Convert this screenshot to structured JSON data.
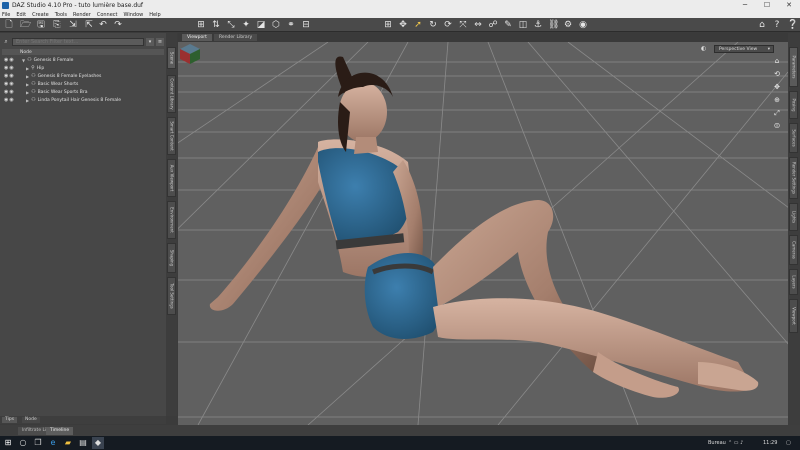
{
  "window": {
    "title": "DAZ Studio 4.10 Pro - tuto lumière base.duf",
    "controls": [
      "─",
      "☐",
      "✕"
    ]
  },
  "menu": [
    "File",
    "Edit",
    "Create",
    "Tools",
    "Render",
    "Connect",
    "Window",
    "Help"
  ],
  "toolbar": {
    "left_icons": [
      "new-icon",
      "open-icon",
      "save-icon",
      "save-as-icon",
      "import-icon",
      "export-icon",
      "undo-icon",
      "redo-icon"
    ],
    "center_left_icons": [
      "scene-icon",
      "align-icon",
      "transform-icon",
      "node-icon",
      "surface-icon",
      "geometry-icon",
      "joint-icon",
      "ruler-icon"
    ],
    "center_icons": [
      "camera-icon",
      "move-icon",
      "select-icon",
      "rotate-icon",
      "spin-icon",
      "translate-icon",
      "scale-icon",
      "pose-icon",
      "surface-selection-icon",
      "region-icon",
      "bone-icon",
      "link-icon",
      "render-settings-icon",
      "render-icon"
    ],
    "right_icons": [
      "home-icon",
      "help-icon",
      "question-icon"
    ]
  },
  "scene": {
    "search_placeholder": "Enter Search Filter text...",
    "header_label": "Node",
    "nodes": [
      {
        "label": "Genesis 8 Female",
        "depth": 0
      },
      {
        "label": "Hip",
        "depth": 1
      },
      {
        "label": "Genesis 8 Female Eyelashes",
        "depth": 1
      },
      {
        "label": "Basic Wear Shorts",
        "depth": 1
      },
      {
        "label": "Basic Wear Sports Bra",
        "depth": 1
      },
      {
        "label": "Linda Ponytail Hair Genesis 8 Female",
        "depth": 1
      }
    ],
    "bottom_tabs": [
      "Tips",
      "Node"
    ]
  },
  "left_side_tabs": [
    "Scene",
    "Content Library",
    "Smart Content",
    "Aux Viewport",
    "Environment",
    "Shaping",
    "Tool Settings"
  ],
  "viewport": {
    "tabs": [
      "Viewport",
      "Render Library"
    ],
    "view_label": "Perspective View"
  },
  "right_side_tabs": [
    "Parameters",
    "Posing",
    "Surfaces",
    "Render Settings",
    "Lights",
    "Cameras",
    "Layers",
    "Viewport"
  ],
  "bottom_tabs": [
    "lnfiltrate Life",
    "Timeline"
  ],
  "taskbar": {
    "apps": [
      "windows-start-icon",
      "search-icon",
      "task-view-icon",
      "edge-icon",
      "file-explorer-icon",
      "store-icon",
      "daz-studio-icon"
    ],
    "tray_label": "Bureau",
    "time": "11:29"
  }
}
